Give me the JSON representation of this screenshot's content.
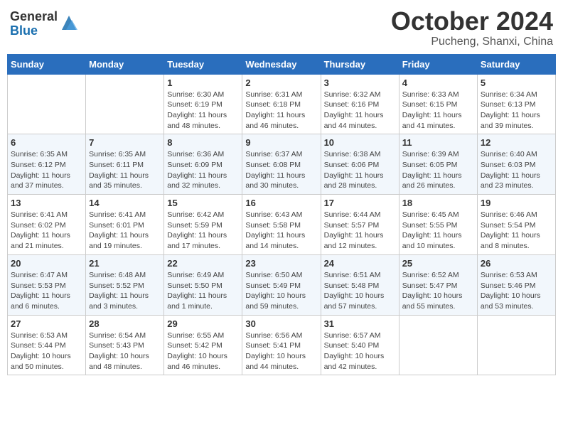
{
  "header": {
    "logo_general": "General",
    "logo_blue": "Blue",
    "month_title": "October 2024",
    "location": "Pucheng, Shanxi, China"
  },
  "columns": [
    "Sunday",
    "Monday",
    "Tuesday",
    "Wednesday",
    "Thursday",
    "Friday",
    "Saturday"
  ],
  "weeks": [
    [
      {
        "day": "",
        "info": ""
      },
      {
        "day": "",
        "info": ""
      },
      {
        "day": "1",
        "info": "Sunrise: 6:30 AM\nSunset: 6:19 PM\nDaylight: 11 hours and 48 minutes."
      },
      {
        "day": "2",
        "info": "Sunrise: 6:31 AM\nSunset: 6:18 PM\nDaylight: 11 hours and 46 minutes."
      },
      {
        "day": "3",
        "info": "Sunrise: 6:32 AM\nSunset: 6:16 PM\nDaylight: 11 hours and 44 minutes."
      },
      {
        "day": "4",
        "info": "Sunrise: 6:33 AM\nSunset: 6:15 PM\nDaylight: 11 hours and 41 minutes."
      },
      {
        "day": "5",
        "info": "Sunrise: 6:34 AM\nSunset: 6:13 PM\nDaylight: 11 hours and 39 minutes."
      }
    ],
    [
      {
        "day": "6",
        "info": "Sunrise: 6:35 AM\nSunset: 6:12 PM\nDaylight: 11 hours and 37 minutes."
      },
      {
        "day": "7",
        "info": "Sunrise: 6:35 AM\nSunset: 6:11 PM\nDaylight: 11 hours and 35 minutes."
      },
      {
        "day": "8",
        "info": "Sunrise: 6:36 AM\nSunset: 6:09 PM\nDaylight: 11 hours and 32 minutes."
      },
      {
        "day": "9",
        "info": "Sunrise: 6:37 AM\nSunset: 6:08 PM\nDaylight: 11 hours and 30 minutes."
      },
      {
        "day": "10",
        "info": "Sunrise: 6:38 AM\nSunset: 6:06 PM\nDaylight: 11 hours and 28 minutes."
      },
      {
        "day": "11",
        "info": "Sunrise: 6:39 AM\nSunset: 6:05 PM\nDaylight: 11 hours and 26 minutes."
      },
      {
        "day": "12",
        "info": "Sunrise: 6:40 AM\nSunset: 6:03 PM\nDaylight: 11 hours and 23 minutes."
      }
    ],
    [
      {
        "day": "13",
        "info": "Sunrise: 6:41 AM\nSunset: 6:02 PM\nDaylight: 11 hours and 21 minutes."
      },
      {
        "day": "14",
        "info": "Sunrise: 6:41 AM\nSunset: 6:01 PM\nDaylight: 11 hours and 19 minutes."
      },
      {
        "day": "15",
        "info": "Sunrise: 6:42 AM\nSunset: 5:59 PM\nDaylight: 11 hours and 17 minutes."
      },
      {
        "day": "16",
        "info": "Sunrise: 6:43 AM\nSunset: 5:58 PM\nDaylight: 11 hours and 14 minutes."
      },
      {
        "day": "17",
        "info": "Sunrise: 6:44 AM\nSunset: 5:57 PM\nDaylight: 11 hours and 12 minutes."
      },
      {
        "day": "18",
        "info": "Sunrise: 6:45 AM\nSunset: 5:55 PM\nDaylight: 11 hours and 10 minutes."
      },
      {
        "day": "19",
        "info": "Sunrise: 6:46 AM\nSunset: 5:54 PM\nDaylight: 11 hours and 8 minutes."
      }
    ],
    [
      {
        "day": "20",
        "info": "Sunrise: 6:47 AM\nSunset: 5:53 PM\nDaylight: 11 hours and 6 minutes."
      },
      {
        "day": "21",
        "info": "Sunrise: 6:48 AM\nSunset: 5:52 PM\nDaylight: 11 hours and 3 minutes."
      },
      {
        "day": "22",
        "info": "Sunrise: 6:49 AM\nSunset: 5:50 PM\nDaylight: 11 hours and 1 minute."
      },
      {
        "day": "23",
        "info": "Sunrise: 6:50 AM\nSunset: 5:49 PM\nDaylight: 10 hours and 59 minutes."
      },
      {
        "day": "24",
        "info": "Sunrise: 6:51 AM\nSunset: 5:48 PM\nDaylight: 10 hours and 57 minutes."
      },
      {
        "day": "25",
        "info": "Sunrise: 6:52 AM\nSunset: 5:47 PM\nDaylight: 10 hours and 55 minutes."
      },
      {
        "day": "26",
        "info": "Sunrise: 6:53 AM\nSunset: 5:46 PM\nDaylight: 10 hours and 53 minutes."
      }
    ],
    [
      {
        "day": "27",
        "info": "Sunrise: 6:53 AM\nSunset: 5:44 PM\nDaylight: 10 hours and 50 minutes."
      },
      {
        "day": "28",
        "info": "Sunrise: 6:54 AM\nSunset: 5:43 PM\nDaylight: 10 hours and 48 minutes."
      },
      {
        "day": "29",
        "info": "Sunrise: 6:55 AM\nSunset: 5:42 PM\nDaylight: 10 hours and 46 minutes."
      },
      {
        "day": "30",
        "info": "Sunrise: 6:56 AM\nSunset: 5:41 PM\nDaylight: 10 hours and 44 minutes."
      },
      {
        "day": "31",
        "info": "Sunrise: 6:57 AM\nSunset: 5:40 PM\nDaylight: 10 hours and 42 minutes."
      },
      {
        "day": "",
        "info": ""
      },
      {
        "day": "",
        "info": ""
      }
    ]
  ]
}
